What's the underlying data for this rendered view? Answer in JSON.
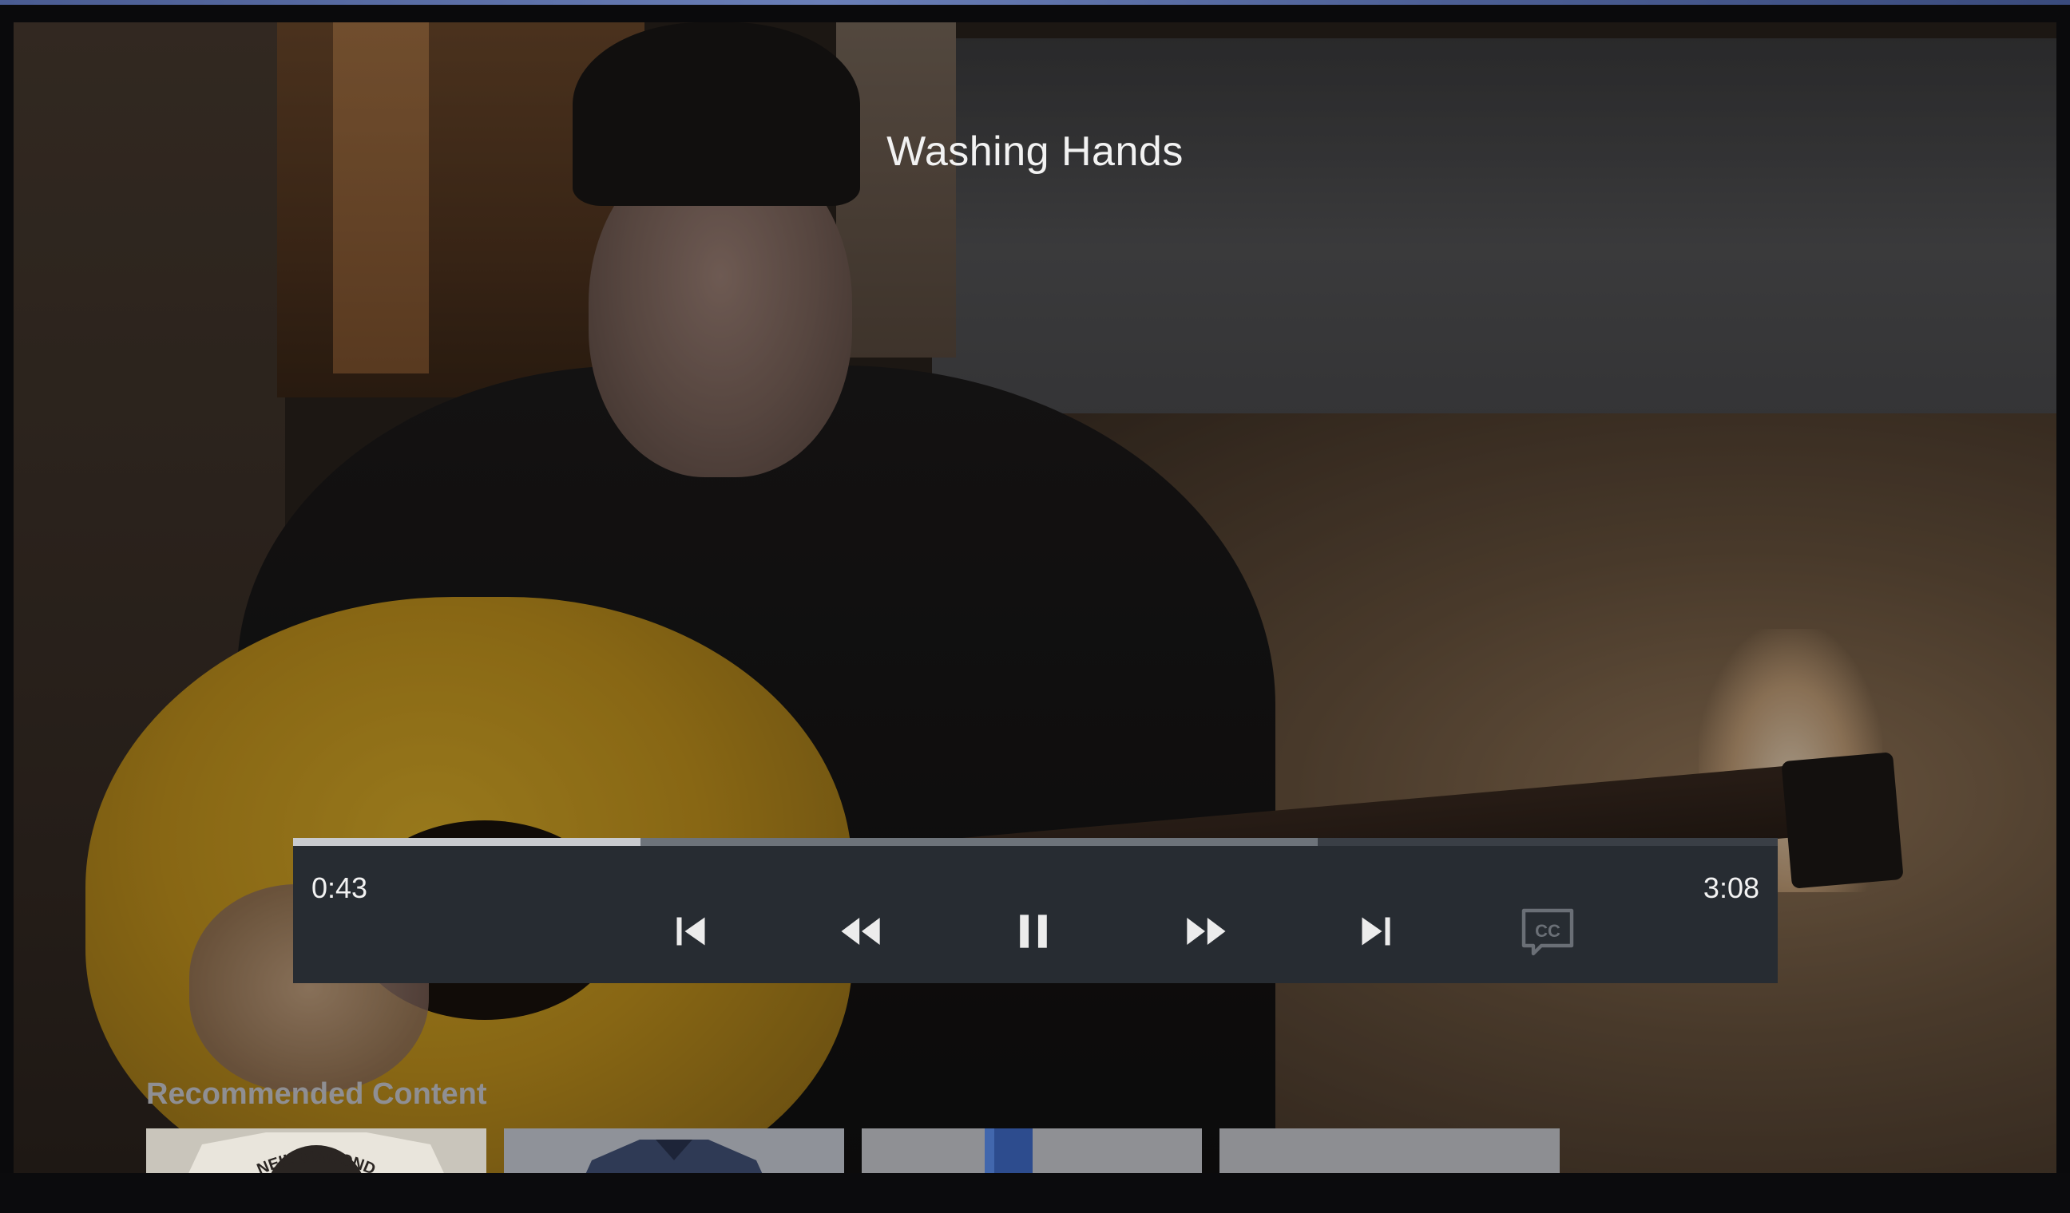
{
  "player": {
    "title": "Washing Hands",
    "current_time": "0:43",
    "total_time": "3:08",
    "progress_fraction": 0.234,
    "buffered_fraction": 0.69,
    "controls": {
      "previous": "skip-previous-icon",
      "rewind": "rewind-icon",
      "pause": "pause-icon",
      "fast_forward": "fast-forward-icon",
      "next": "skip-next-icon",
      "captions": "closed-captions-icon"
    }
  },
  "recommended": {
    "label": "Recommended Content",
    "items": [
      {
        "name": "neil-diamond-tshirt",
        "thumb_text": "NEIL DIAMOND"
      },
      {
        "name": "denim-jacket"
      },
      {
        "name": "blue-bottle"
      },
      {
        "name": "dark-product"
      }
    ]
  },
  "colors": {
    "control_bar": "#272c32",
    "progress_played": "#c9cbcf",
    "progress_buffer": "#6d737a",
    "icon": "#ececec",
    "captions_icon_disabled": "#6a6f76",
    "recommended_label": "#8f8f93"
  }
}
